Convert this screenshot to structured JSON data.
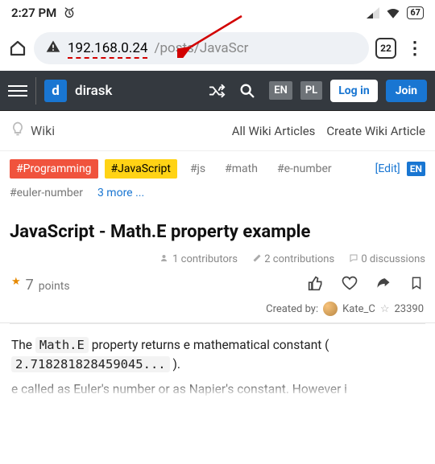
{
  "status": {
    "time": "2:27 PM",
    "battery": "67"
  },
  "browser": {
    "ip": "192.168.0.24",
    "path": "/posts/JavaScr",
    "tabs": "22"
  },
  "header": {
    "brand": "dirask",
    "lang1": "EN",
    "lang2": "PL",
    "login": "Log in",
    "join": "Join"
  },
  "subnav": {
    "wiki": "Wiki",
    "all": "All Wiki Articles",
    "create": "Create Wiki Article"
  },
  "tags": {
    "programming": "#Programming",
    "javascript": "#JavaScript",
    "js": "#js",
    "math": "#math",
    "enumber": "#e-number",
    "euler": "#euler-number",
    "more": "3 more ...",
    "edit": "[Edit]",
    "langbox": "EN"
  },
  "article": {
    "title": "JavaScript - Math.E property example",
    "contributors": "1  contributors",
    "contributions": "2  contributions",
    "discussions": "0  discussions",
    "points_num": "7",
    "points_lbl": "points",
    "created_label": "Created by:",
    "author": "Kate_C",
    "author_score": "23390"
  },
  "body": {
    "t1": "The ",
    "code1": "Math.E",
    "t2": " property returns e mathematical constant ( ",
    "code2": "2.718281828459045...",
    "t3": " ).",
    "next": "e called as Euler's number or as Napier's constant. However i"
  }
}
